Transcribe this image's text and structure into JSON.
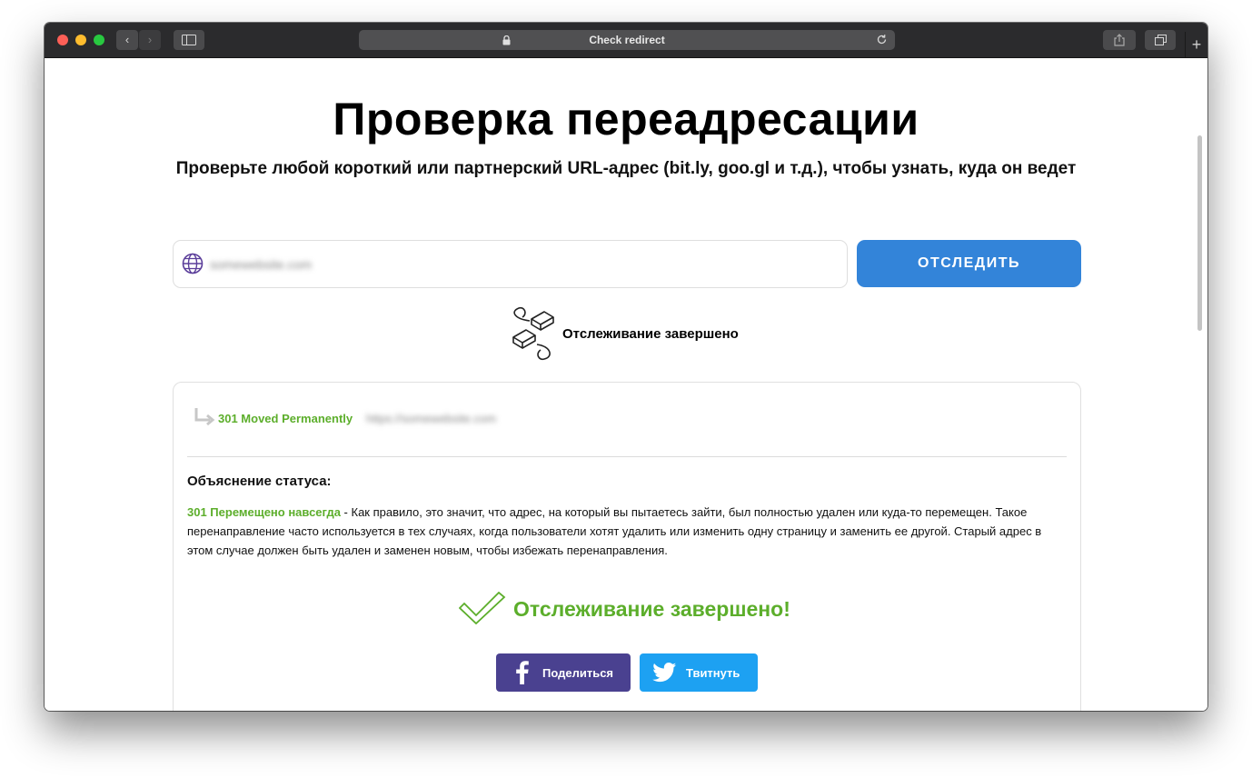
{
  "browser": {
    "title": "Check redirect",
    "back_label": "‹",
    "forward_label": "›",
    "new_tab_label": "+"
  },
  "page": {
    "heading": "Проверка переадресации",
    "subheading": "Проверьте любой короткий или партнерский URL-адрес (bit.ly, goo.gl и т.д.), чтобы узнать, куда он ведет",
    "url_value": "somewebsite.com",
    "track_button": "ОТСЛЕДИТЬ",
    "tracking_status": "Отслеживание завершено"
  },
  "result": {
    "hop_status": "301 Moved Permanently",
    "hop_url": "https://somewebsite.com",
    "explanation_heading": "Объяснение статуса:",
    "explanation_term": "301 Перемещено навсегда",
    "explanation_text": " - Как правило, это значит, что адрес, на который вы пытаетесь зайти, был полностью удален или куда-то перемещен. Такое перенаправление часто используется в тех случаях, когда пользователи хотят удалить или изменить одну страницу и заменить ее другой. Старый адрес в этом случае должен быть удален и заменен новым, чтобы избежать перенаправления.",
    "done_text": "Отслеживание завершено!",
    "share_facebook": "Поделиться",
    "share_twitter": "Твитнуть"
  },
  "colors": {
    "accent_blue": "#3384d9",
    "success_green": "#5cae2b",
    "facebook": "#4a4190",
    "twitter": "#1da1f2"
  },
  "icons": [
    "back-icon",
    "forward-icon",
    "sidebar-icon",
    "lock-icon",
    "reload-icon",
    "share-icon",
    "tabs-icon",
    "globe-icon",
    "broken-link-icon",
    "redirect-arrow-icon",
    "checkmark-icon",
    "facebook-icon",
    "twitter-icon"
  ]
}
